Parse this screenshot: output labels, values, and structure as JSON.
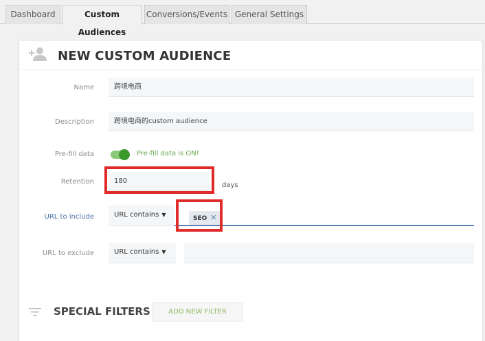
{
  "tabs": [
    {
      "label": "Dashboard"
    },
    {
      "label": "Custom Audiences"
    },
    {
      "label": "Conversions/Events"
    },
    {
      "label": "General Settings"
    }
  ],
  "card": {
    "title": "NEW CUSTOM AUDIENCE",
    "header_icon": "add-person-icon"
  },
  "form": {
    "name_label": "Name",
    "name_value": "跨境电商",
    "description_label": "Description",
    "description_value": "跨境电商的custom audience",
    "prefill_label": "Pre-fill data",
    "prefill_on": true,
    "prefill_status": "Pre-fill data is ON!",
    "retention_label": "Retention",
    "retention_value": "180",
    "retention_unit": "days",
    "include_label": "URL to include",
    "include_match": "URL contains",
    "include_tags": [
      "SEO"
    ],
    "exclude_label": "URL to exclude",
    "exclude_match": "URL contains"
  },
  "filters": {
    "title": "SPECIAL FILTERS",
    "add_button": "ADD NEW FILTER"
  },
  "colors": {
    "toggle_on": "#3c9a2c",
    "highlight": "#e02b2b",
    "accent_blue": "#5b7fb0"
  }
}
